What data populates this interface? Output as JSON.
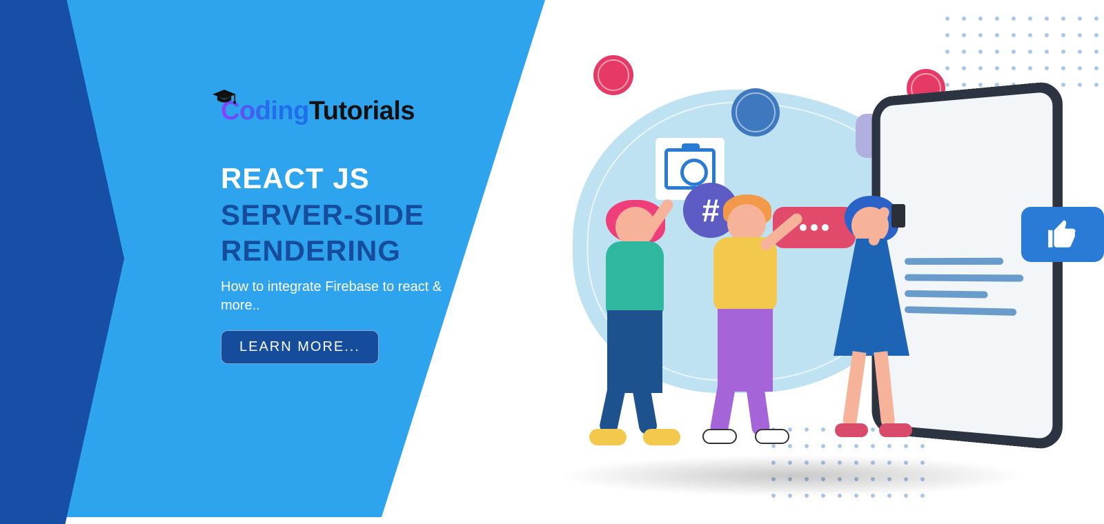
{
  "logo": {
    "part1": "Coding",
    "part2": "Tutorials"
  },
  "heading": {
    "line1": "REACT JS",
    "line2": "SERVER-SIDE",
    "line3": "RENDERING"
  },
  "subtitle": "How to integrate Firebase to react & more..",
  "button": {
    "label": "LEARN MORE..."
  },
  "icons": {
    "hash_text": "#"
  },
  "colors": {
    "primary_light": "#2ea3ee",
    "primary_dark": "#154d9c",
    "accent_pink": "#e63a66",
    "accent_purple": "#5d5bc4"
  }
}
